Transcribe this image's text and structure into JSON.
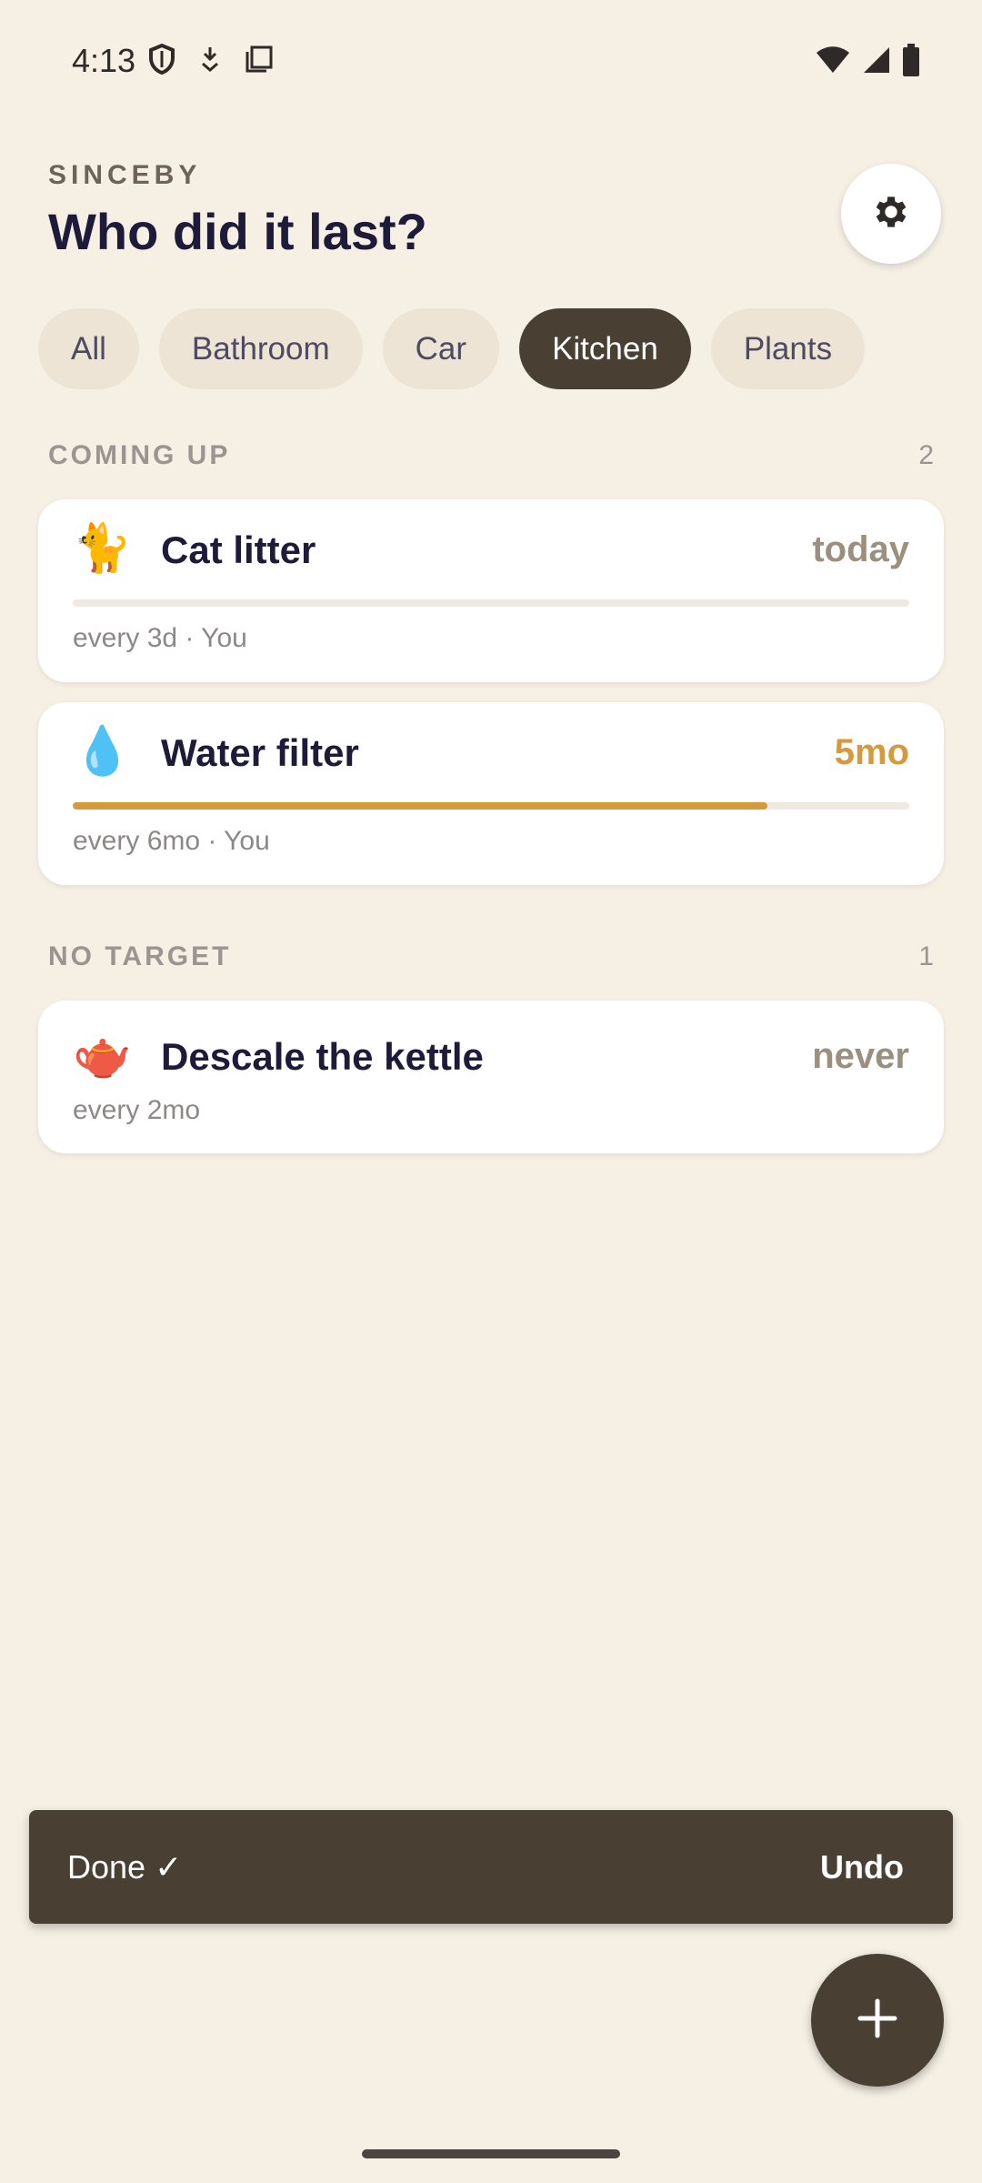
{
  "status_bar": {
    "time": "4:13",
    "icons_left": [
      "shield-icon",
      "download-icon",
      "copy-icon"
    ],
    "icons_right": [
      "wifi-icon",
      "cell-signal-icon",
      "battery-icon"
    ]
  },
  "header": {
    "app_name": "SINCEBY",
    "title": "Who did it last?",
    "settings_icon": "gear-icon"
  },
  "filters": [
    {
      "label": "All",
      "active": false
    },
    {
      "label": "Bathroom",
      "active": false
    },
    {
      "label": "Car",
      "active": false
    },
    {
      "label": "Kitchen",
      "active": true
    },
    {
      "label": "Plants",
      "active": false
    }
  ],
  "sections": {
    "coming_up": {
      "label": "COMING UP",
      "count": "2",
      "items": [
        {
          "emoji": "🐈",
          "icon": "cat-icon",
          "title": "Cat litter",
          "since": "today",
          "since_color": "#9B8F7D",
          "progress": 0.0,
          "meta": "every 3d · You"
        },
        {
          "emoji": "💧",
          "icon": "droplet-icon",
          "title": "Water filter",
          "since": "5mo",
          "since_color": "#D69A3C",
          "progress": 0.83,
          "meta": "every 6mo · You"
        }
      ]
    },
    "no_target": {
      "label": "NO TARGET",
      "count": "1",
      "items": [
        {
          "emoji": "🫖",
          "icon": "teapot-icon",
          "title": "Descale the kettle",
          "since": "never",
          "since_color": "#9B8F7D",
          "meta": "every 2mo"
        }
      ]
    }
  },
  "snackbar": {
    "message": "Done ✓",
    "action": "Undo"
  },
  "fab": {
    "icon": "plus-icon"
  },
  "colors": {
    "background": "#F6EFE4",
    "accent": "#D69A3C",
    "dark": "#4A3F33"
  }
}
